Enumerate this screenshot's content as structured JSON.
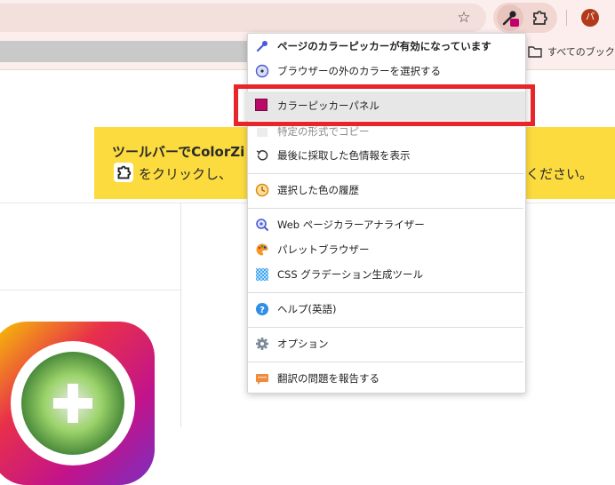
{
  "browser": {
    "avatar_letter": "パ",
    "bookmarks_label": "すべてのブックマ"
  },
  "banner": {
    "title": "ツールバーでColorZi",
    "text_start": "をクリックし、",
    "text_end": "ください。"
  },
  "menu": {
    "items": [
      {
        "label": "ページのカラーピッカーが有効になっています",
        "icon": "eyedropper-icon"
      },
      {
        "label": "ブラウザーの外のカラーを選択する",
        "icon": "screen-picker-icon"
      },
      {
        "label": "カラーピッカーパネル",
        "icon": "color-swatch-icon"
      },
      {
        "label": "特定の形式でコピー",
        "icon": "copy-format-icon"
      },
      {
        "label": "最後に採取した色情報を表示",
        "icon": "history-arrow-icon"
      },
      {
        "label": "選択した色の履歴",
        "icon": "clock-history-icon"
      },
      {
        "label": "Web ページカラーアナライザー",
        "icon": "analyzer-magnifier-icon"
      },
      {
        "label": "パレットブラウザー",
        "icon": "palette-icon"
      },
      {
        "label": "CSS グラデーション生成ツール",
        "icon": "gradient-icon"
      },
      {
        "label": "ヘルプ(英語)",
        "icon": "help-icon"
      },
      {
        "label": "オプション",
        "icon": "gear-icon"
      },
      {
        "label": "翻訳の問題を報告する",
        "icon": "report-icon"
      }
    ]
  },
  "colors": {
    "swatch": "#b80a66",
    "highlight": "#e8252b",
    "banner": "#fcdb3f"
  }
}
